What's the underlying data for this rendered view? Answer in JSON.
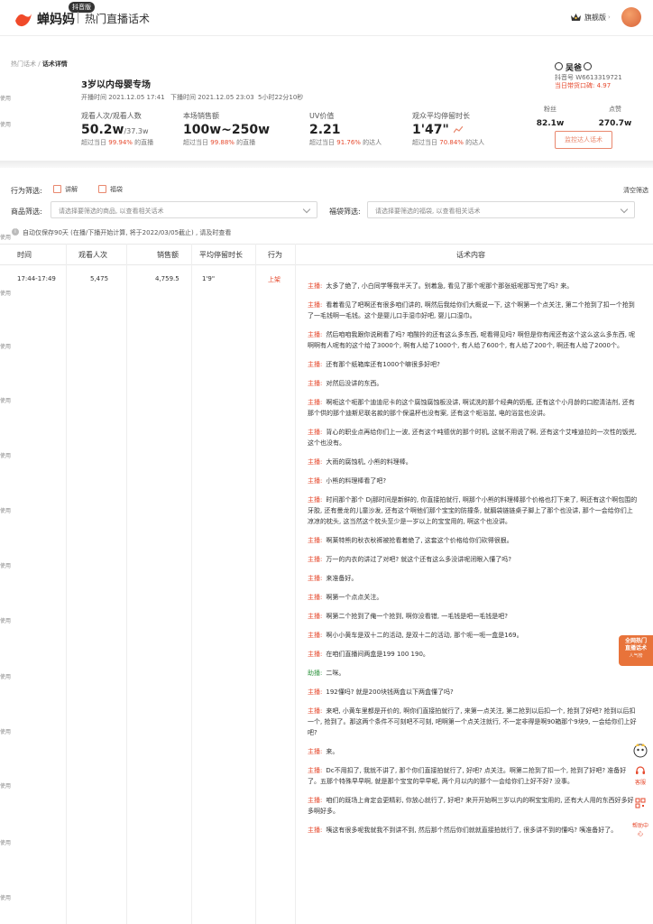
{
  "header": {
    "brand": "蝉妈妈",
    "brand_badge": "抖音版",
    "product": "热门直播话术",
    "version_label": "旗舰版",
    "version_caret": "›"
  },
  "breadcrumb": {
    "parent": "热门话术",
    "sep": " / ",
    "current": "话术详情"
  },
  "room": {
    "title": "3岁以内母婴专场",
    "start": "开播时间  2021.12.05 17:41",
    "end": "下播时间  2021.12.05 23:03",
    "duration": "5小时22分10秒"
  },
  "streamer": {
    "name": "吴爸",
    "douyin_id": "抖音号 W6613319721",
    "rating": "当日带货口碑: 4.97"
  },
  "stats": [
    {
      "label": "观看人次/观看人数",
      "value": "50.2w",
      "value_extra": "/37.3w",
      "sub_prefix": "超过当日 ",
      "sub_pct": "99.94%",
      "sub_suffix": " 的直播"
    },
    {
      "label": "本场销售额",
      "value": "100w~250w",
      "value_extra": "",
      "sub_prefix": "超过当日 ",
      "sub_pct": "99.88%",
      "sub_suffix": " 的直播"
    },
    {
      "label": "UV价值",
      "value": "2.21",
      "value_extra": "",
      "sub_prefix": "超过当日 ",
      "sub_pct": "91.76%",
      "sub_suffix": " 的达人"
    },
    {
      "label": "观众平均停留时长",
      "value": "1'47\"",
      "value_extra": "",
      "sub_prefix": "超过当日 ",
      "sub_pct": "70.84%",
      "sub_suffix": " 的达人"
    }
  ],
  "fans": {
    "fans_label": "粉丝",
    "fans_value": "82.1w",
    "likes_label": "点赞",
    "likes_value": "270.7w"
  },
  "monitor_button": "监控达人话术",
  "filters": {
    "behavior_label": "行为筛选:",
    "opt_explain": "讲解",
    "opt_bag": "福袋",
    "clear": "清空筛选",
    "product_label": "商品筛选:",
    "product_placeholder": "请选择要筛选的商品, 以查看相关话术",
    "bag_label": "福袋筛选:",
    "bag_placeholder": "请选择要筛选的福袋, 以查看相关话术"
  },
  "note": {
    "icon": "i",
    "text": "自动仅保存90天 (在播/下播开始计算, 将于2022/03/05截止) , 请及时查看"
  },
  "table": {
    "headers": [
      "时间",
      "观看人次",
      "销售额",
      "平均停留时长",
      "行为",
      "话术内容"
    ],
    "row": {
      "time": "17:44-17:49",
      "views": "5,475",
      "sales": "4,759.5",
      "stay": "1'9\"",
      "action": "上架"
    }
  },
  "scripts": [
    {
      "speaker": "主播:",
      "type": "host",
      "text": "太多了绝了, 小白同学等我半天了。别着急, 看见了那个呢那个那张纸呢那写完了吗? 来。"
    },
    {
      "speaker": "主播:",
      "type": "host",
      "text": "看着看见了吧啊还有很多咱们讲的, 啊然后我给你们大概说一下, 这个啊第一个点关注, 第二个抢到了扣一个抢到了一毛钱啊一毛钱。这个是婴儿口手湿巾好吧, 婴儿口湿巾。"
    },
    {
      "speaker": "主播:",
      "type": "host",
      "text": "然后咱咱我跟你说刷看了吗? 咱酸拎的还有这么多东西, 呢看得见吗? 啊但是你有闹还有这个这么这么多东西, 呢啊啊有人呢有的这个给了3000个, 啊有人给了1000个, 有人给了600个, 有人给了200个, 啊还有人给了2000个。"
    },
    {
      "speaker": "主播:",
      "type": "host",
      "text": "还有那个纸箱库还有1000个嘛很多好吧?"
    },
    {
      "speaker": "主播:",
      "type": "host",
      "text": "对然后没讲的东西。"
    },
    {
      "speaker": "主播:",
      "type": "host",
      "text": "啊呃这个呃那个迪迪尼卡的这个腐蚀腐蚀板没讲, 啊试洗的那个经典的奶瓶, 还有这个小月龄的口腔清洁剂, 还有那个供的那个迪斯尼联名款的那个保温杯也没有案, 还有这个呃浴盆, 电的浴盆也没讲。"
    },
    {
      "speaker": "主播:",
      "type": "host",
      "text": "背心的职业点再给你们上一波, 还有这个吨德优的那个时机, 这就不用说了啊, 还有这个艾唯迪拉的一次性的饭兜, 这个也没有。"
    },
    {
      "speaker": "主播:",
      "type": "host",
      "text": "大雨的腐蚀机, 小熊的料理棒。"
    },
    {
      "speaker": "主播:",
      "type": "host",
      "text": "小熊的料理棒看了吧?"
    },
    {
      "speaker": "主播:",
      "type": "host",
      "text": "时间那个那个 Dj那时间是新鲜的, 你直接拍就行, 啊那个小熊的料理棒那个价格也打下来了, 啊还有这个啊包围的牙胶, 还有曼龙的儿童沙发, 还有这个啊他们那个宝宝的防撞条, 就膈袋链链桌子脚上了那个也没讲, 那个一会给你们上凉凉的枕头, 这当然这个枕头至少是一岁以上的宝宝用的, 啊这个也没讲。"
    },
    {
      "speaker": "主播:",
      "type": "host",
      "text": "啊莱特熊的秋衣秋裤被抢看着绝了, 这套这个价格给你们砍得很狠。"
    },
    {
      "speaker": "主播:",
      "type": "host",
      "text": "万一的内衣的讲过了对吧? 就这个还有这么多没讲呢闭眼入懂了吗?"
    },
    {
      "speaker": "主播:",
      "type": "host",
      "text": "来准备好。"
    },
    {
      "speaker": "主播:",
      "type": "host",
      "text": "啊第一个点点关注。"
    },
    {
      "speaker": "主播:",
      "type": "host",
      "text": "啊第二个抢到了俺一个抢到, 啊你没看错, 一毛钱是吧一毛钱是吧?"
    },
    {
      "speaker": "主播:",
      "type": "host",
      "text": "啊小小黄车是双十二的活动, 是双十二的活动, 那个呃一呃一盒是169。"
    },
    {
      "speaker": "主播:",
      "type": "host",
      "text": "在咱们直播间两盒是199 100 190。"
    },
    {
      "speaker": "助播:",
      "type": "assist",
      "text": "二咪。"
    },
    {
      "speaker": "主播:",
      "type": "host",
      "text": "192懂吗? 就是200块钱两盒以下两盒懂了吗?"
    },
    {
      "speaker": "主播:",
      "type": "host",
      "text": "来吧, 小黄车里都是开价的, 啊你们直接拍就行了, 来第一点关注, 第二抢到以后扣一个, 抢到了好吧? 抢到以后扣一个, 抢到了。那这两个条件不可刻吧不可刻, 吧啊第一个点关注就行, 不一定非得是啊90箱那个9块9, 一会给你们上好吧?"
    },
    {
      "speaker": "主播:",
      "type": "host",
      "text": "来。"
    },
    {
      "speaker": "主播:",
      "type": "host",
      "text": "Dc不用扣了, 我就不讲了, 那个你们直接拍就行了, 好吧? 点关注。啊第二抢到了扣一个, 抢到了好吧? 准备好了。五那个特殊早早啊, 就是那个宝宝的早早呢, 两个月以内的那个一会给你们上好不好? 没事。"
    },
    {
      "speaker": "主播:",
      "type": "host",
      "text": "咱们的既场上肯定会更精彩, 你放心就行了, 好吧? 来开开始啊三岁以内的啊宝宝用的, 还有大人用的东西好多好多啊好多。"
    },
    {
      "speaker": "主播:",
      "type": "host",
      "text": "咦这有很多呢我就我不到讲不到, 然后那个然后你们就就直接拍就行了, 很多讲不到的懂吗? 咦准备好了。"
    }
  ],
  "side_strip_label": "使用",
  "float_banner": {
    "line1": "全网热门",
    "line2": "直播话术",
    "line3": "人气榜"
  },
  "side_tools": {
    "customer": "客服",
    "help": "帮助中心"
  },
  "colors": {
    "accent": "#e64a2e",
    "assist": "#3a9a4a",
    "banner": "#e8733a"
  },
  "icons": {
    "logo": "logo-icon",
    "version": "crown-icon",
    "trend": "trend-icon",
    "info": "info-icon",
    "mascot": "mascot-icon",
    "customer": "headset-icon",
    "help": "qrcode-icon"
  }
}
